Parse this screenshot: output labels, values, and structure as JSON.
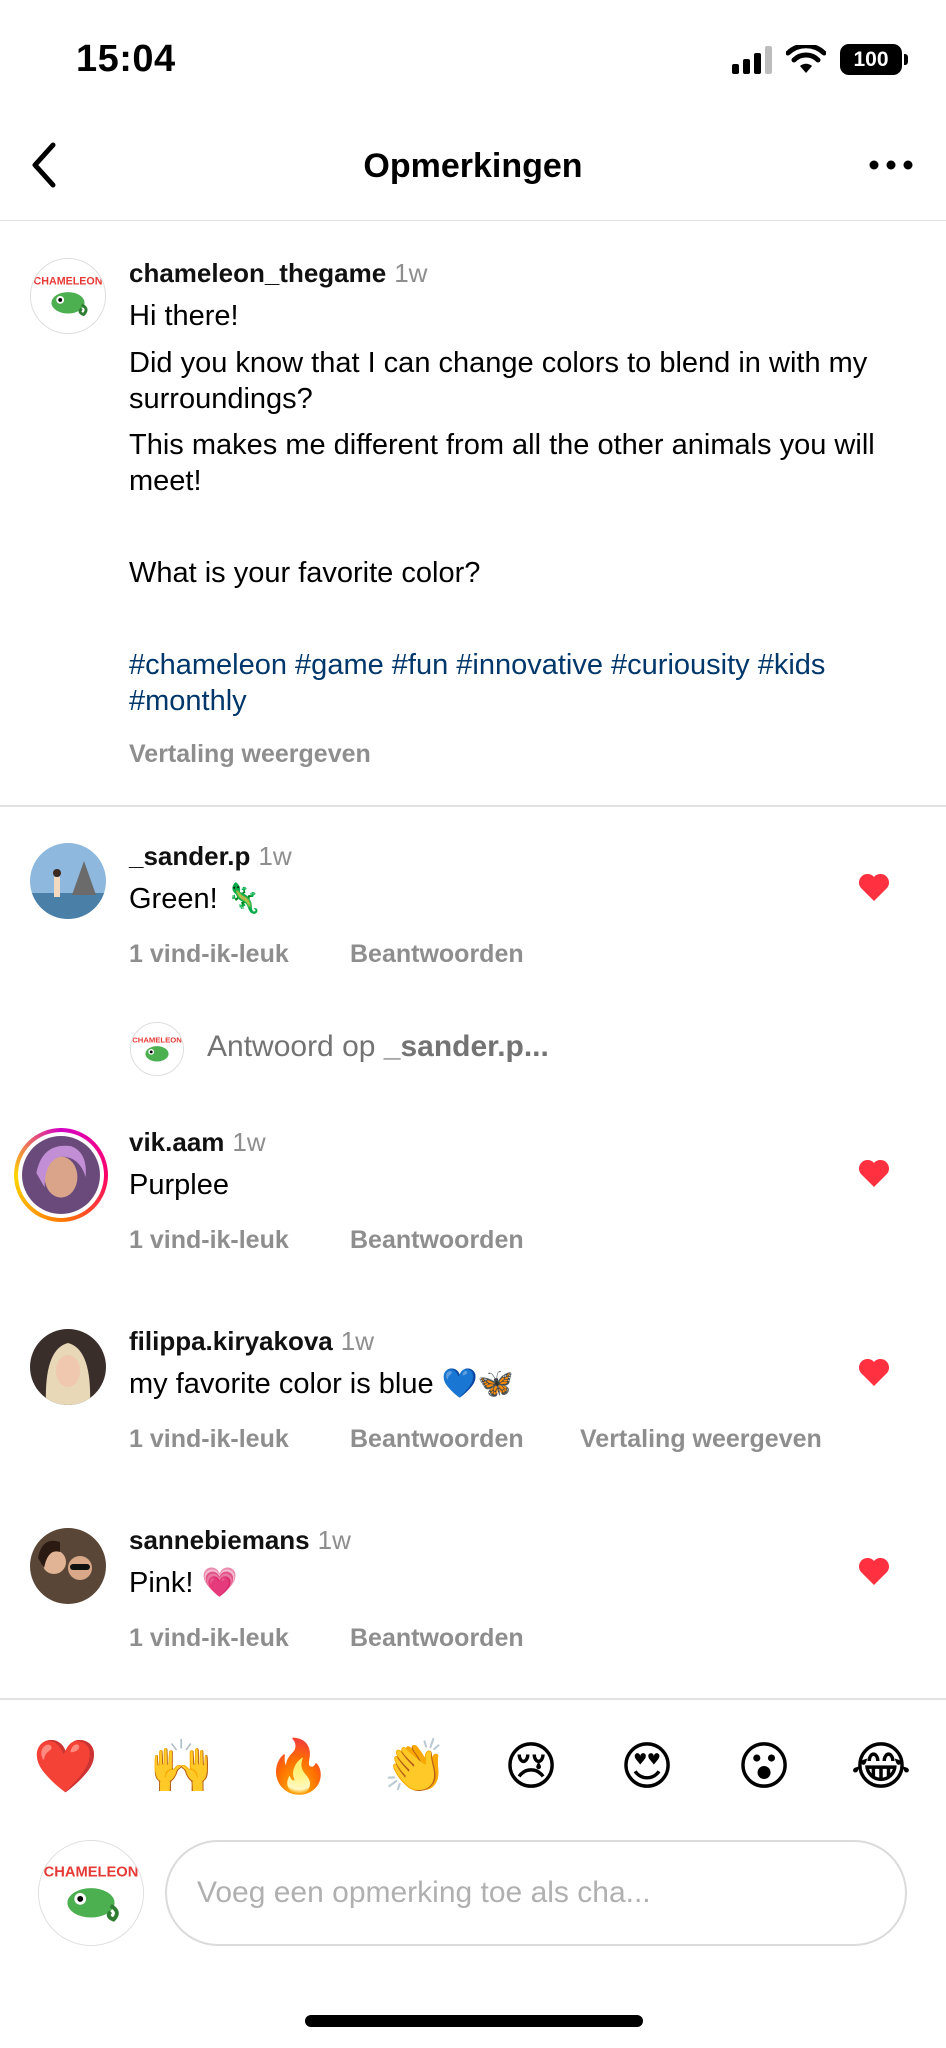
{
  "status": {
    "time": "15:04",
    "battery": "100"
  },
  "nav": {
    "title": "Opmerkingen"
  },
  "post": {
    "username": "chameleon_thegame",
    "age": "1w",
    "lines": [
      "Hi there!",
      "Did you know that I can change colors to blend in with my surroundings?",
      "This makes me different from all the other animals you will meet!",
      "What is your favorite color?"
    ],
    "hashtags": "#chameleon #game #fun #innovative #curiousity #kids #monthly",
    "translate": "Vertaling weergeven"
  },
  "comments": [
    {
      "username": "_sander.p",
      "age": "1w",
      "text": "Green! 🦎",
      "likes": "1 vind-ik-leuk",
      "reply": "Beantwoorden"
    },
    {
      "username": "vik.aam",
      "age": "1w",
      "text": "Purplee",
      "likes": "1 vind-ik-leuk",
      "reply": "Beantwoorden"
    },
    {
      "username": "filippa.kiryakova",
      "age": "1w",
      "text": "my favorite color is blue 💙🦋",
      "likes": "1 vind-ik-leuk",
      "reply": "Beantwoorden",
      "translate": "Vertaling weergeven"
    },
    {
      "username": "sannebiemans",
      "age": "1w",
      "text": "Pink! 💗",
      "likes": "1 vind-ik-leuk",
      "reply": "Beantwoorden"
    }
  ],
  "reply_prompt": {
    "prefix": "Antwoord op ",
    "target": "_sander.p..."
  },
  "emojis": [
    "❤️",
    "🙌",
    "🔥",
    "👏",
    "😢",
    "😍",
    "😮",
    "😂"
  ],
  "composer": {
    "placeholder": "Voeg een opmerking toe als cha..."
  },
  "colors": {
    "heart": "#ff3040",
    "hashtag": "#00376b",
    "secondary": "#8e8e8e"
  }
}
